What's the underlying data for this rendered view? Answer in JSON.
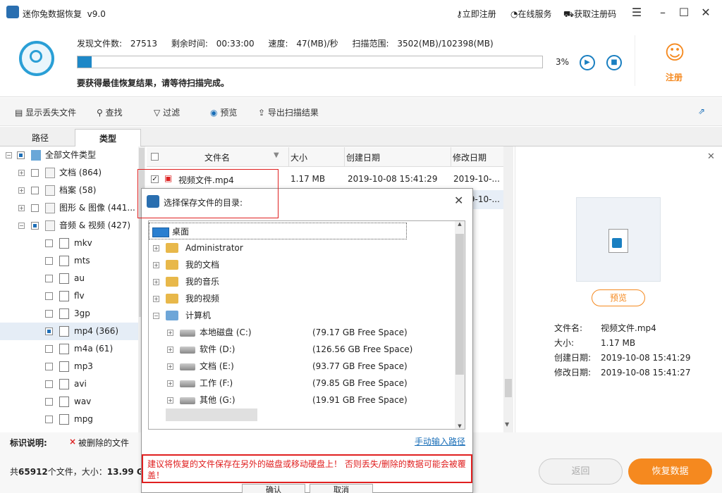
{
  "app": {
    "title": "迷你兔数据恢复",
    "version": "v9.0"
  },
  "titlebar": {
    "register": "立即注册",
    "online": "在线服务",
    "getcode": "获取注册码"
  },
  "scan": {
    "found_label": "发现文件数:",
    "found": "27513",
    "remain_label": "剩余时间:",
    "remain": "00:33:00",
    "speed_label": "速度:",
    "speed": "47(MB)/秒",
    "range_label": "扫描范围:",
    "range": "3502(MB)/102398(MB)",
    "percent": "3%",
    "progress": 0.03,
    "tip": "要获得最佳恢复结果，请等待扫描完成。",
    "register_label": "注册"
  },
  "toolbar": {
    "show_lost": "显示丢失文件",
    "find": "查找",
    "filter": "过滤",
    "preview": "预览",
    "export": "导出扫描结果"
  },
  "tabs": {
    "path": "路径",
    "type": "类型"
  },
  "tree": [
    {
      "label": "全部文件类型",
      "level": 0
    },
    {
      "label": "文档 (864)",
      "level": 1
    },
    {
      "label": "档案 (58)",
      "level": 1
    },
    {
      "label": "图形 & 图像 (441...",
      "level": 1
    },
    {
      "label": "音频 & 视频 (427)",
      "level": 1
    },
    {
      "label": "mkv",
      "level": 2
    },
    {
      "label": "mts",
      "level": 2
    },
    {
      "label": "au",
      "level": 2
    },
    {
      "label": "flv",
      "level": 2
    },
    {
      "label": "3gp",
      "level": 2
    },
    {
      "label": "mp4 (366)",
      "level": 2
    },
    {
      "label": "m4a (61)",
      "level": 2
    },
    {
      "label": "mp3",
      "level": 2
    },
    {
      "label": "avi",
      "level": 2
    },
    {
      "label": "wav",
      "level": 2
    },
    {
      "label": "mpg",
      "level": 2
    }
  ],
  "list": {
    "headers": {
      "name": "文件名",
      "size": "大小",
      "created": "创建日期",
      "modified": "修改日期"
    },
    "rows": [
      {
        "name": "视频文件.mp4",
        "size": "1.17 MB",
        "created": "2019-10-08 15:41:29",
        "modified": "2019-10-..."
      },
      {
        "name": "",
        "size": "",
        "created": "",
        "modified": "2019-10-..."
      }
    ]
  },
  "preview": {
    "button": "预览",
    "name_label": "文件名:",
    "name": "视频文件.mp4",
    "size_label": "大小:",
    "size": "1.17 MB",
    "created_label": "创建日期:",
    "created": "2019-10-08 15:41:29",
    "modified_label": "修改日期:",
    "modified": "2019-10-08 15:41:27"
  },
  "bottom": {
    "legend_label": "标识说明:",
    "legend_x": "×",
    "legend_text": "被删除的文件",
    "summary_prefix": "共",
    "total": "65912",
    "summary_mid": "个文件，大小：",
    "total_size": "13.99 GB...",
    "back": "返回",
    "recover": "恢复数据"
  },
  "dialog": {
    "title": "选择保存文件的目录:",
    "items": [
      {
        "label": "桌面"
      },
      {
        "label": "Administrator"
      },
      {
        "label": "我的文档"
      },
      {
        "label": "我的音乐"
      },
      {
        "label": "我的视频"
      },
      {
        "label": "计算机"
      },
      {
        "label": "本地磁盘 (C:)",
        "free": "(79.17 GB Free Space)"
      },
      {
        "label": "软件 (D:)",
        "free": "(126.56 GB Free Space)"
      },
      {
        "label": "文档 (E:)",
        "free": "(93.77 GB Free Space)"
      },
      {
        "label": "工作 (F:)",
        "free": "(79.85 GB Free Space)"
      },
      {
        "label": "其他 (G:)",
        "free": "(19.91 GB Free Space)"
      }
    ],
    "manual_path": "手动输入路径",
    "warning": "建议将恢复的文件保存在另外的磁盘或移动硬盘上！ 否则丢失/删除的数据可能会被覆盖！",
    "ok": "确认",
    "cancel": "取消"
  },
  "colors": {
    "accent": "#1e88c7",
    "orange": "#f5891f",
    "warning_red": "#e02020"
  }
}
